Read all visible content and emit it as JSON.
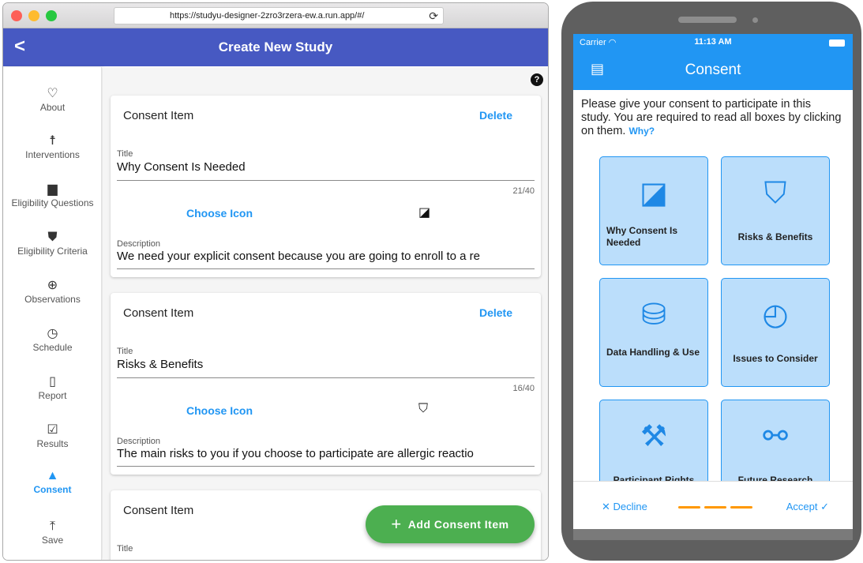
{
  "browser": {
    "url": "https://studyu-designer-2zro3rzera-ew.a.run.app/#/",
    "app_title": "Create New Study",
    "sidebar": [
      {
        "label": "About",
        "icon": "heart-outline-icon"
      },
      {
        "label": "Interventions",
        "icon": "person-icon"
      },
      {
        "label": "Eligibility Questions",
        "icon": "chat-icon"
      },
      {
        "label": "Eligibility Criteria",
        "icon": "shield-icon"
      },
      {
        "label": "Observations",
        "icon": "zoom-in-icon"
      },
      {
        "label": "Schedule",
        "icon": "clock-icon"
      },
      {
        "label": "Report",
        "icon": "clipboard-icon"
      },
      {
        "label": "Results",
        "icon": "checkbox-clipboard-icon"
      },
      {
        "label": "Consent",
        "icon": "warning-icon",
        "active": true
      },
      {
        "label": "Save",
        "icon": "upload-icon"
      }
    ],
    "cards": [
      {
        "header": "Consent Item",
        "delete_label": "Delete",
        "title_label": "Title",
        "title_value": "Why Consent Is Needed",
        "counter": "21/40",
        "choose_icon_label": "Choose Icon",
        "description_label": "Description",
        "description_value": "We need your explicit consent because you are going to enroll to a re"
      },
      {
        "header": "Consent Item",
        "delete_label": "Delete",
        "title_label": "Title",
        "title_value": "Risks & Benefits",
        "counter": "16/40",
        "choose_icon_label": "Choose Icon",
        "description_label": "Description",
        "description_value": "The main risks to you if you choose to participate are allergic reactio"
      },
      {
        "header": "Consent Item",
        "title_label": "Title"
      }
    ],
    "fab_label": "Add Consent Item",
    "help_icon": "?"
  },
  "phone": {
    "carrier": "Carrier",
    "time": "11:13 AM",
    "toolbar_title": "Consent",
    "intro_text": "Please give your consent to participate in this study. You are required to read all boxes by clicking on them.",
    "why_link": "Why?",
    "tiles": [
      {
        "label": "Why Consent Is Needed",
        "icon": "document-search-icon"
      },
      {
        "label": "Risks & Benefits",
        "icon": "roadblock-icon"
      },
      {
        "label": "Data Handling & Use",
        "icon": "database-export-icon"
      },
      {
        "label": "Issues to Consider",
        "icon": "map-clock-icon"
      },
      {
        "label": "Participant Rights",
        "icon": "gavel-icon"
      },
      {
        "label": "Future Research",
        "icon": "binoculars-icon"
      }
    ],
    "decline_label": "Decline",
    "accept_label": "Accept",
    "progress_color": "#ff9800",
    "accent_color": "#2196f3"
  }
}
